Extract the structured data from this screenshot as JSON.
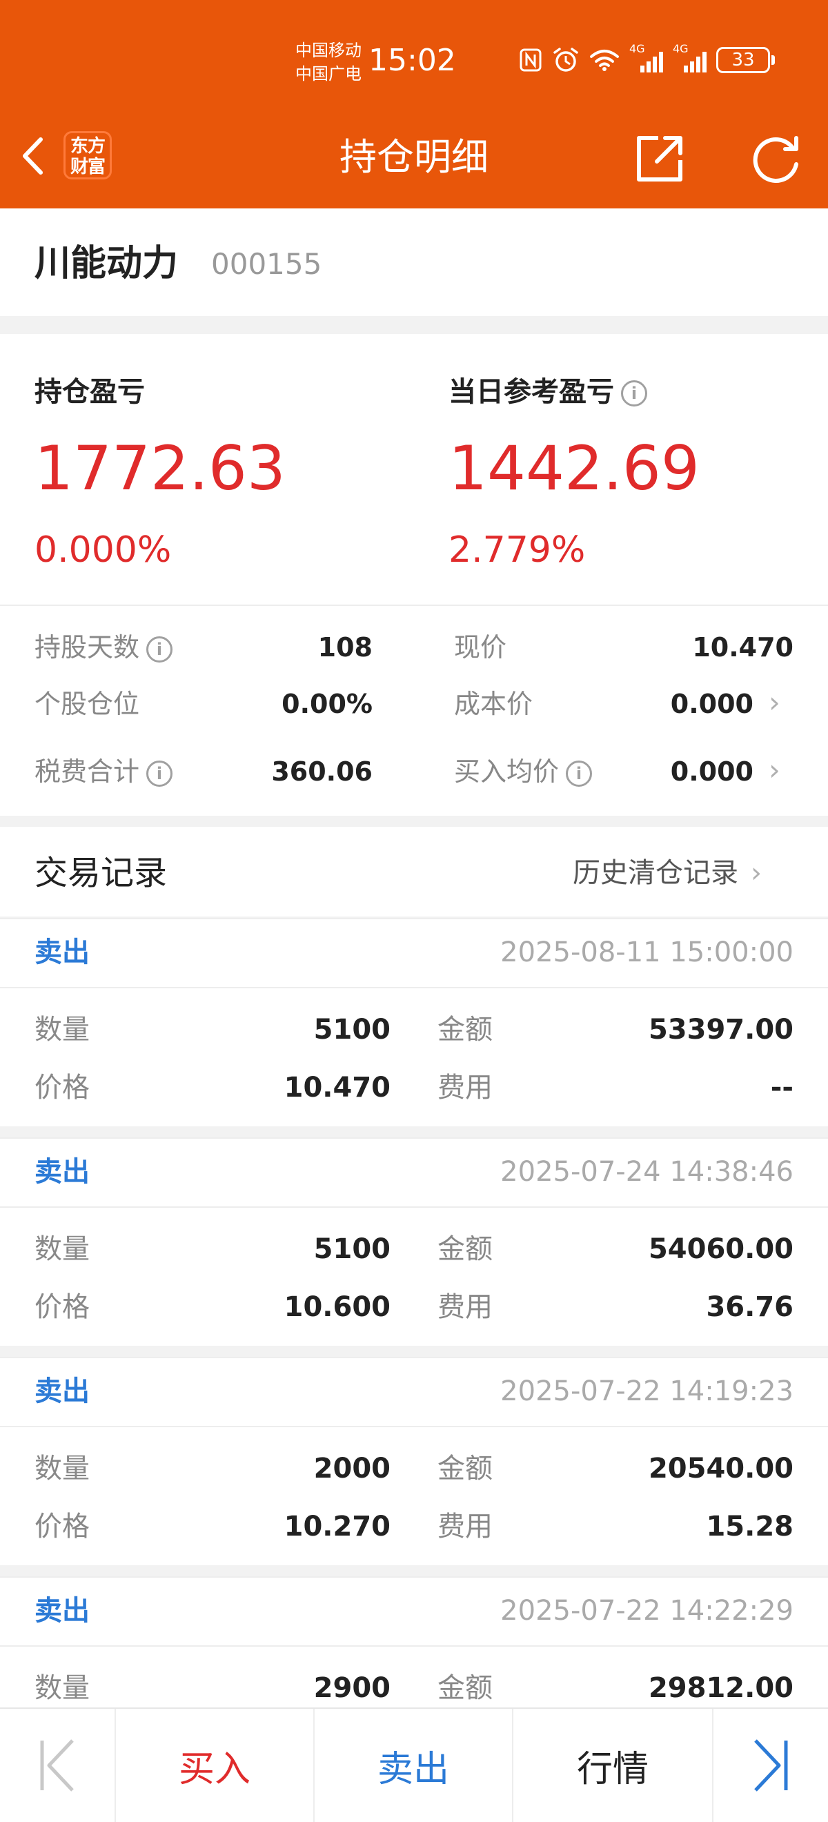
{
  "status_bar": {
    "carrier_1": "中国移动",
    "carrier_2": "中国广电",
    "time": "15:02",
    "network_1": "4G",
    "network_2": "4G",
    "battery": "33",
    "icons": [
      "nfc-icon",
      "alarm-icon",
      "wifi-icon",
      "signal-icon",
      "battery-icon"
    ]
  },
  "header": {
    "title": "持仓明细",
    "logo_text_1": "东方",
    "logo_text_2": "财富",
    "icons": [
      "back-chevron-icon",
      "share-icon",
      "refresh-icon"
    ]
  },
  "stock": {
    "name": "川能动力",
    "code": "000155"
  },
  "summary": {
    "position_pl_label": "持仓盈亏",
    "position_pl_value": "1772.63",
    "position_pl_pct": "0.000%",
    "daily_pl_label": "当日参考盈亏",
    "daily_pl_value": "1442.69",
    "daily_pl_pct": "2.779%"
  },
  "details": {
    "days_label": "持股天数",
    "days_value": "108",
    "current_price_label": "现价",
    "current_price_value": "10.470",
    "position_ratio_label": "个股仓位",
    "position_ratio_value": "0.00%",
    "cost_price_label": "成本价",
    "cost_price_value": "0.000",
    "fees_label": "税费合计",
    "fees_value": "360.06",
    "avg_buy_label": "买入均价",
    "avg_buy_value": "0.000"
  },
  "records": {
    "title": "交易记录",
    "history_link": "历史清仓记录",
    "qty_label": "数量",
    "amount_label": "金额",
    "price_label": "价格",
    "fee_label": "费用",
    "items": [
      {
        "type": "卖出",
        "time": "2025-08-11 15:00:00",
        "qty": "5100",
        "amount": "53397.00",
        "price": "10.470",
        "fee": "--"
      },
      {
        "type": "卖出",
        "time": "2025-07-24 14:38:46",
        "qty": "5100",
        "amount": "54060.00",
        "price": "10.600",
        "fee": "36.76"
      },
      {
        "type": "卖出",
        "time": "2025-07-22 14:19:23",
        "qty": "2000",
        "amount": "20540.00",
        "price": "10.270",
        "fee": "15.28"
      },
      {
        "type": "卖出",
        "time": "2025-07-22 14:22:29",
        "qty": "2900",
        "amount": "29812.00",
        "price": "",
        "fee": ""
      }
    ]
  },
  "bottom_bar": {
    "buy": "买入",
    "sell": "卖出",
    "quote": "行情",
    "colors": {
      "buy": "#e02b2b",
      "sell": "#2b7ad6",
      "quote": "#222222"
    }
  },
  "colors": {
    "brand": "#e8560a",
    "profit_red": "#e02b2b",
    "sell_blue": "#2b7ad6"
  }
}
